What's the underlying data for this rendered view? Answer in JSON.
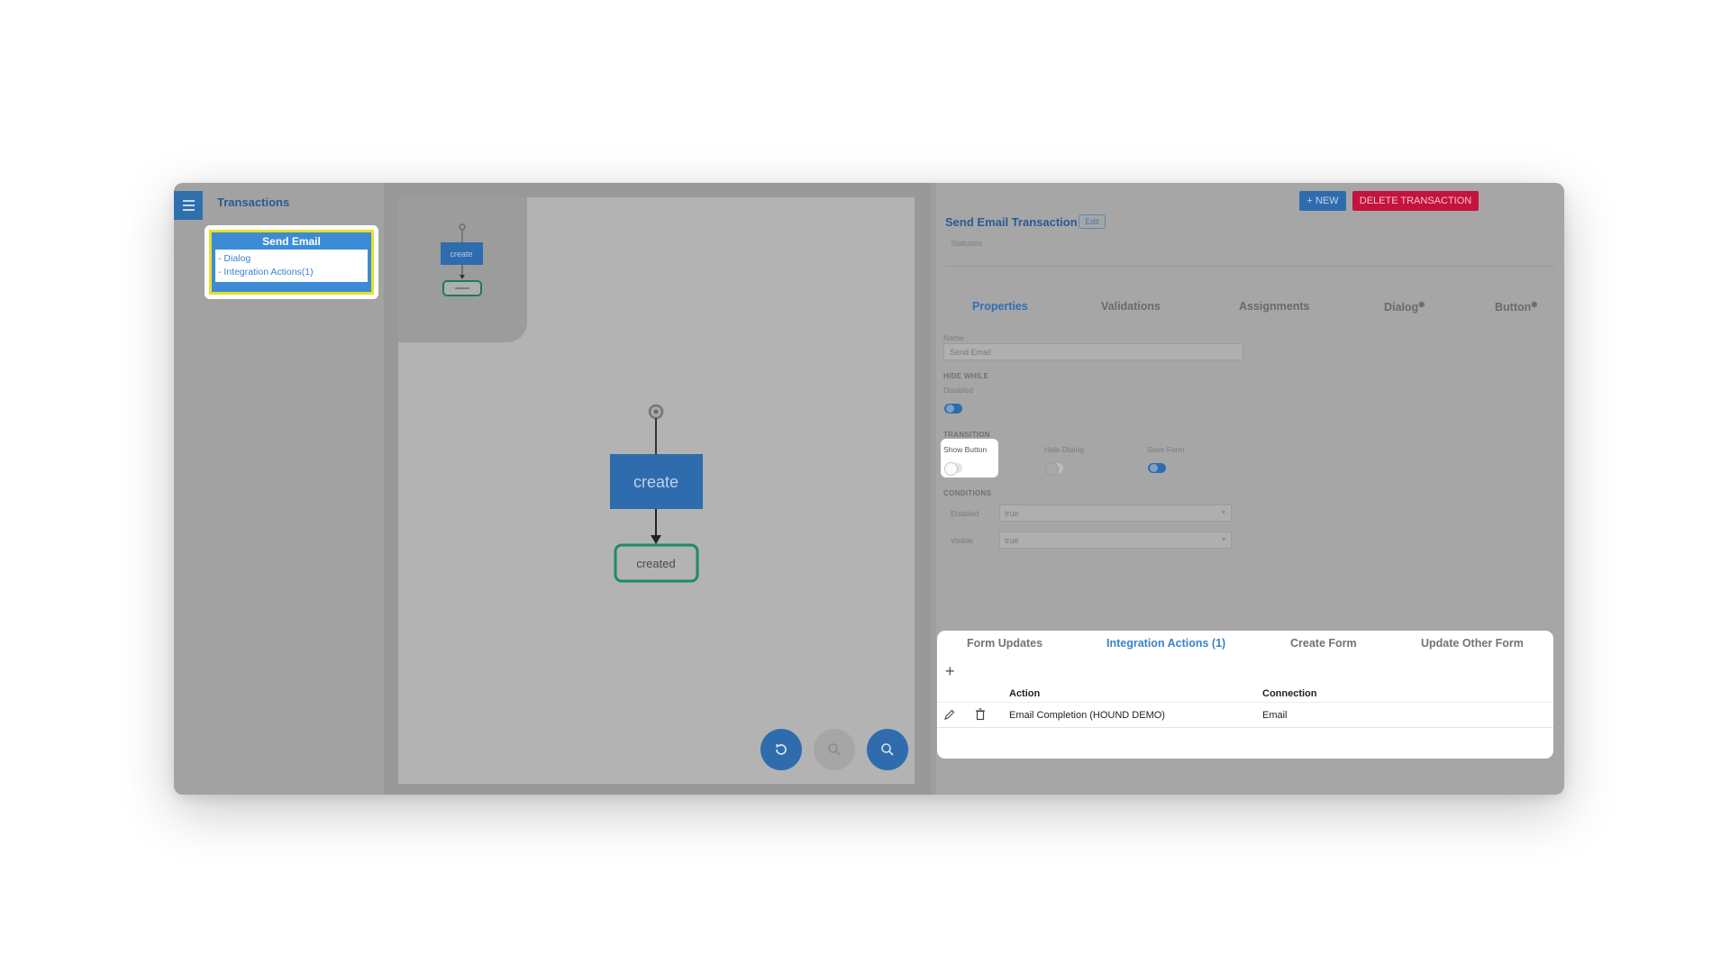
{
  "sidebar": {
    "title": "Transactions",
    "card": {
      "title": "Send Email",
      "items": [
        "- Dialog",
        "- Integration Actions(1)"
      ]
    }
  },
  "canvas": {
    "minimap_node_label": "create",
    "start_node_label": "create",
    "end_node_label": "created"
  },
  "toolbar": {
    "new_label": "+ NEW",
    "delete_label": "DELETE TRANSACTION"
  },
  "transaction": {
    "heading": "Send Email Transaction",
    "edit_label": "Edit",
    "statuses_label": "Statuses"
  },
  "tabs": [
    {
      "label": "Properties",
      "active": true
    },
    {
      "label": "Validations"
    },
    {
      "label": "Assignments"
    },
    {
      "label": "Dialog"
    },
    {
      "label": "Button"
    }
  ],
  "properties": {
    "name_label": "Name",
    "name_value": "Send Email",
    "hide_while_label": "HIDE WHILE",
    "disabled_label": "Disabled",
    "disabled_on": true,
    "transition_label": "TRANSITION",
    "show_button_label": "Show Button",
    "show_button_on": false,
    "hide_dialog_label": "Hide Dialog",
    "hide_dialog_on": false,
    "save_form_label": "Save Form",
    "save_form_on": true,
    "conditions_label": "CONDITIONS",
    "enabled_label": "Enabled",
    "enabled_value": "true",
    "visible_label": "Visible",
    "visible_value": "true"
  },
  "bottom": {
    "tabs": [
      {
        "label": "Form Updates"
      },
      {
        "label": "Integration Actions (1)",
        "active": true
      },
      {
        "label": "Create Form"
      },
      {
        "label": "Update Other Form"
      }
    ],
    "columns": [
      "Action",
      "Connection"
    ],
    "rows": [
      {
        "action": "Email Completion (HOUND DEMO)",
        "connection": "Email"
      }
    ]
  },
  "colors": {
    "primary": "#2e6cae",
    "danger": "#c4133e",
    "highlight": "#e6df2a",
    "node_blue": "#2e78c9",
    "node_green": "#1c9a79"
  }
}
